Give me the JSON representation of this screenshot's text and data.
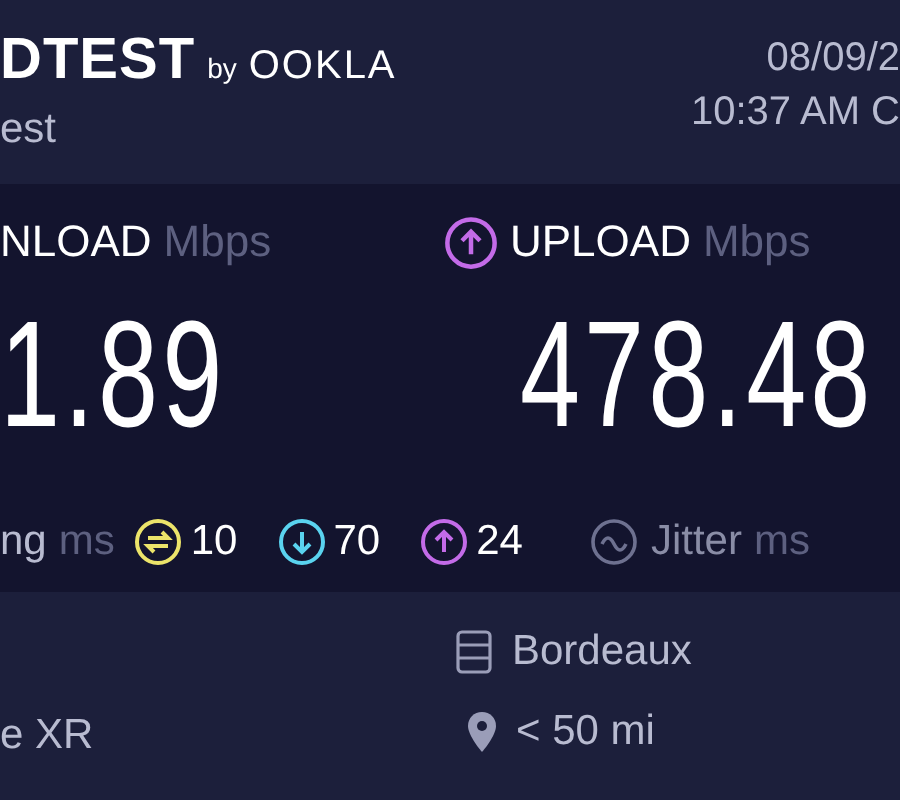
{
  "header": {
    "logo": "DTEST",
    "logo_by": "by",
    "logo_brand": "OOKLA",
    "subtitle": "est",
    "date": "08/09/2",
    "time": "10:37 AM C"
  },
  "results": [
    {
      "kind": "download",
      "label": "NLOAD",
      "unit": "Mbps",
      "value": "1.89"
    },
    {
      "kind": "upload",
      "label": "UPLOAD",
      "unit": "Mbps",
      "value": "478.48"
    }
  ],
  "ping": {
    "label": "ng",
    "unit": "ms",
    "stats": [
      {
        "kind": "idle",
        "value": "10",
        "color": "#ece46a"
      },
      {
        "kind": "download",
        "value": "70",
        "color": "#5ad3ef"
      },
      {
        "kind": "upload",
        "value": "24",
        "color": "#c36be8"
      }
    ]
  },
  "jitter": {
    "label": "Jitter",
    "unit": "ms"
  },
  "device": "e XR",
  "server": {
    "name": "Bordeaux",
    "distance": "< 50 mi"
  }
}
